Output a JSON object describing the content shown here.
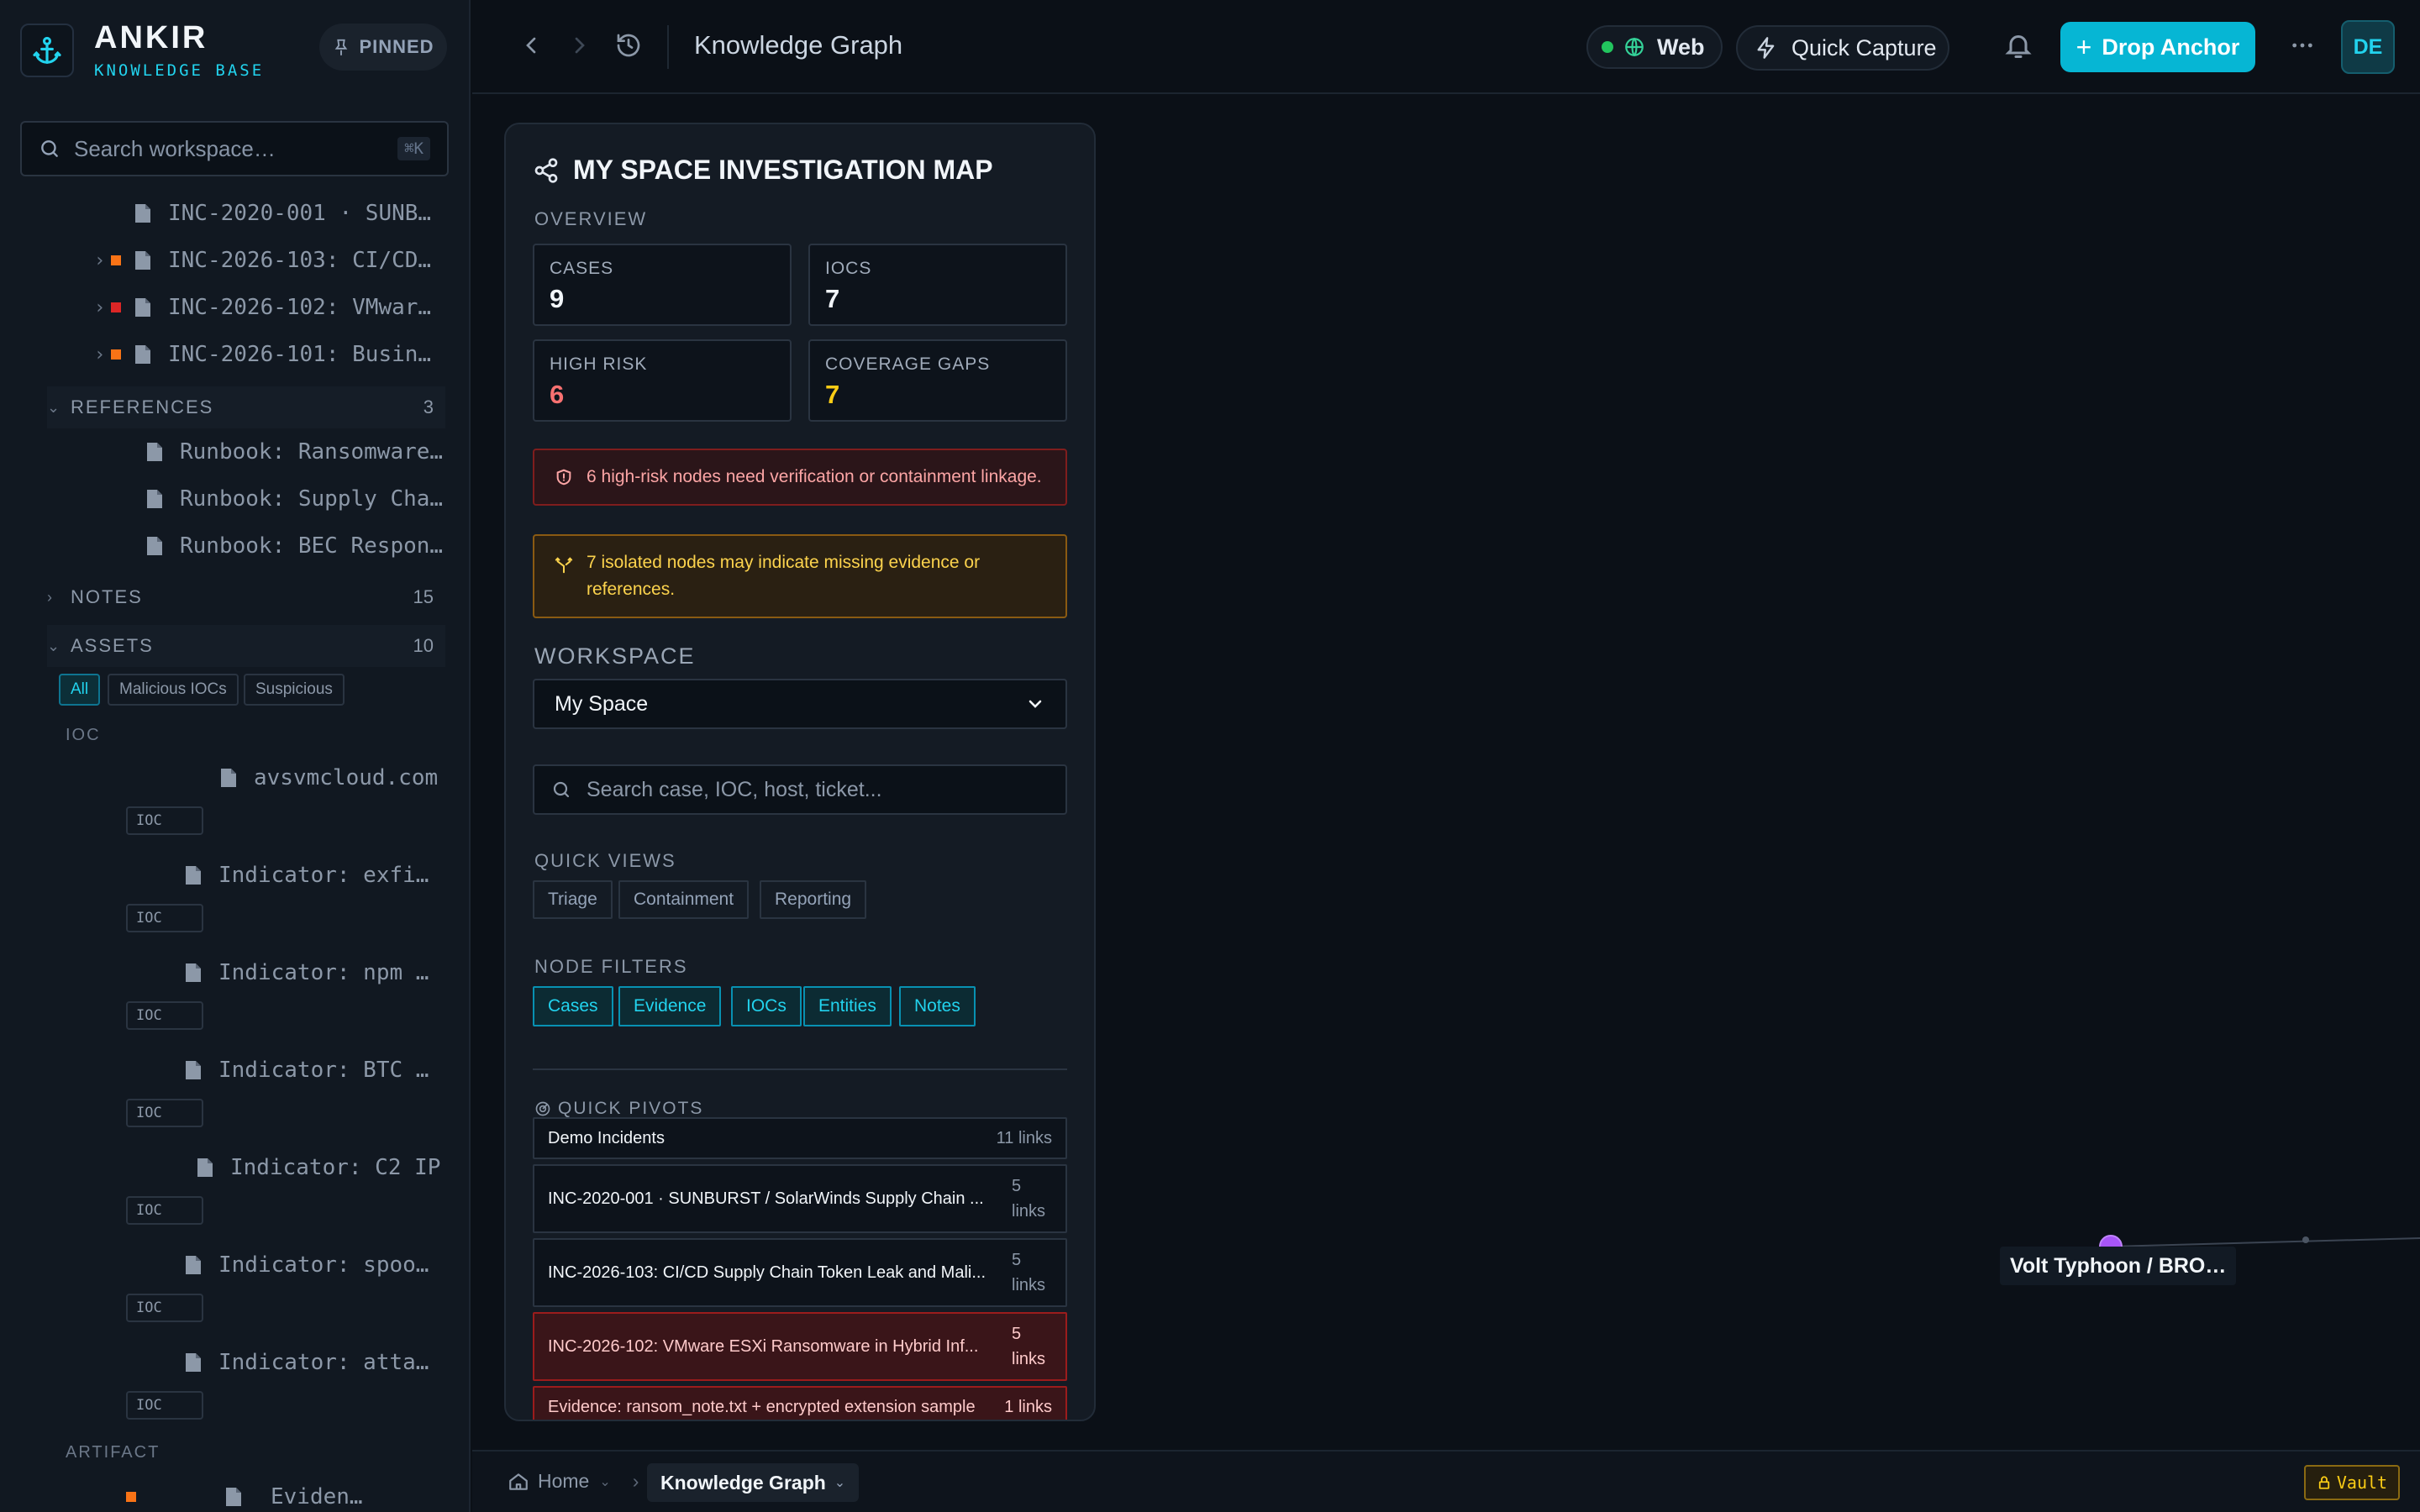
{
  "brand": {
    "name": "ANKIR",
    "subtitle": "KNOWLEDGE BASE",
    "pinned_label": "PINNED"
  },
  "sidebar": {
    "search": {
      "placeholder": "Search workspace…",
      "shortcut": "⌘K"
    },
    "cases": [
      {
        "label": "INC-2020-001 · SUNB…",
        "status": ""
      },
      {
        "label": "INC-2026-103: CI/CD…",
        "status": "#f97316"
      },
      {
        "label": "INC-2026-102: VMwar…",
        "status": "#dc2626"
      },
      {
        "label": "INC-2026-101: Busin…",
        "status": "#f97316"
      }
    ],
    "references": {
      "title": "REFERENCES",
      "count": "3",
      "items": [
        "Runbook: Ransomware…",
        "Runbook: Supply Cha…",
        "Runbook: BEC Respon…"
      ]
    },
    "notes": {
      "title": "NOTES",
      "count": "15"
    },
    "assets": {
      "title": "ASSETS",
      "count": "10",
      "filters": [
        "All",
        "Malicious IOCs",
        "Suspicious"
      ],
      "ioc_group": "IOC",
      "ioc_items": [
        {
          "label": "avsvmcloud.com",
          "badge": "IOC"
        },
        {
          "label": "Indicator: exfi…",
          "badge": "IOC"
        },
        {
          "label": "Indicator: npm …",
          "badge": "IOC"
        },
        {
          "label": "Indicator: BTC …",
          "badge": "IOC"
        },
        {
          "label": "Indicator: C2 IP",
          "badge": "IOC"
        },
        {
          "label": "Indicator: spoo…",
          "badge": "IOC"
        },
        {
          "label": "Indicator: atta…",
          "badge": "IOC"
        }
      ],
      "artifact_group": "ARTIFACT",
      "artifact_items": [
        {
          "label": "Eviden…",
          "status": "#f97316"
        }
      ]
    }
  },
  "header": {
    "title": "Knowledge Graph",
    "web_label": "Web",
    "quick_capture": "Quick Capture",
    "drop_anchor": "Drop Anchor",
    "avatar": "DE"
  },
  "panel": {
    "title": "MY SPACE INVESTIGATION MAP",
    "overview_label": "OVERVIEW",
    "stats": {
      "cases": {
        "label": "CASES",
        "value": "9"
      },
      "iocs": {
        "label": "IOCS",
        "value": "7"
      },
      "high_risk": {
        "label": "HIGH RISK",
        "value": "6"
      },
      "coverage_gaps": {
        "label": "COVERAGE GAPS",
        "value": "7"
      }
    },
    "alert_high_risk": "6 high-risk nodes need verification or containment linkage.",
    "alert_isolated": "7 isolated nodes may indicate missing evidence or references.",
    "workspace_label": "WORKSPACE",
    "workspace_value": "My Space",
    "search_placeholder": "Search case, IOC, host, ticket...",
    "quick_views_label": "QUICK VIEWS",
    "quick_views": [
      "Triage",
      "Containment",
      "Reporting"
    ],
    "node_filters_label": "NODE FILTERS",
    "node_filters": [
      "Cases",
      "Evidence",
      "IOCs",
      "Entities",
      "Notes"
    ],
    "quick_pivots_label": "QUICK PIVOTS",
    "pivots": [
      {
        "label": "Demo Incidents",
        "links": "11 links"
      },
      {
        "label": "INC-2020-001 · SUNBURST / SolarWinds Supply Chain ...",
        "links": "5 links"
      },
      {
        "label": "INC-2026-103: CI/CD Supply Chain Token Leak and Mali...",
        "links": "5 links"
      },
      {
        "label": "INC-2026-102: VMware ESXi Ransomware in Hybrid Inf...",
        "links": "5 links"
      },
      {
        "label": "Evidence: ransom_note.txt + encrypted extension sample",
        "links": "1 links"
      }
    ]
  },
  "graph": {
    "node_label": "Volt Typhoon / BRO…",
    "node_color": "#a855f7"
  },
  "footer": {
    "home": "Home",
    "current": "Knowledge Graph",
    "vault": "Vault"
  },
  "colors": {
    "accent": "#06b6d4",
    "danger": "#f87171",
    "warning": "#facc15"
  }
}
